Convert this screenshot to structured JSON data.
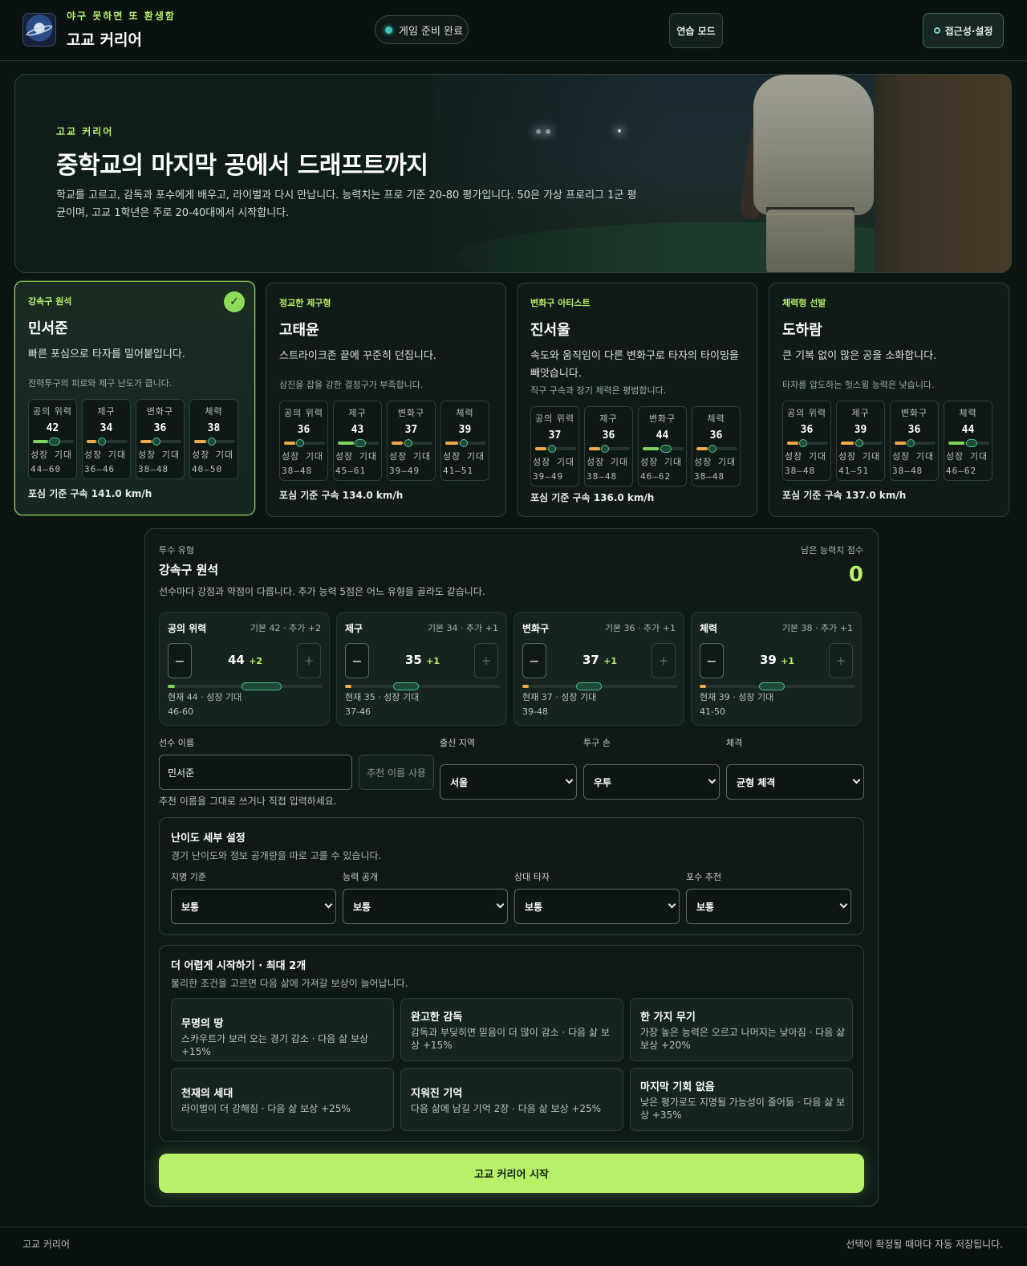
{
  "header": {
    "tagline": "야구 못하면 또 환생함",
    "title": "고교 커리어",
    "status": "게임 준비 완료",
    "practice_label": "연습 모드",
    "settings_label": "접근성·설정"
  },
  "hero": {
    "kicker": "고교 커리어",
    "title": "중학교의 마지막 공에서 드래프트까지",
    "description": "학교를 고르고, 감독과 포수에게 배우고, 라이벌과 다시 만납니다. 능력치는 프로 기준 20-80 평가입니다. 50은 가상 프로리그 1군 평균이며, 고교 1학년은 주로 20-40대에서 시작합니다."
  },
  "stat_labels": [
    "공의 위력",
    "제구",
    "변화구",
    "체력"
  ],
  "growth_label": "성장 기대",
  "pitchers": [
    {
      "type": "강속구 원석",
      "name": "민서준",
      "selected": true,
      "description": "빠른 포심으로 타자를 밀어붙입니다.",
      "weakness": "전력투구의 피로와 제구 난도가 큽니다.",
      "stats": [
        {
          "value": "42",
          "growth": "44–60",
          "level": 42,
          "pot_min": 44,
          "pot_max": 60
        },
        {
          "value": "34",
          "growth": "36–46",
          "level": 34,
          "pot_min": 36,
          "pot_max": 46
        },
        {
          "value": "36",
          "growth": "38–48",
          "level": 36,
          "pot_min": 38,
          "pot_max": 48
        },
        {
          "value": "38",
          "growth": "40–50",
          "level": 38,
          "pot_min": 40,
          "pot_max": 50
        }
      ],
      "velocity": "포심 기준 구속 141.0 km/h"
    },
    {
      "type": "정교한 제구형",
      "name": "고태윤",
      "selected": false,
      "description": "스트라이크존 끝에 꾸준히 던집니다.",
      "weakness": "삼진을 잡을 강한 결정구가 부족합니다.",
      "stats": [
        {
          "value": "36",
          "growth": "38–48",
          "level": 36,
          "pot_min": 38,
          "pot_max": 48
        },
        {
          "value": "43",
          "growth": "45–61",
          "level": 43,
          "pot_min": 45,
          "pot_max": 61
        },
        {
          "value": "37",
          "growth": "39–49",
          "level": 37,
          "pot_min": 39,
          "pot_max": 49
        },
        {
          "value": "39",
          "growth": "41–51",
          "level": 39,
          "pot_min": 41,
          "pot_max": 51
        }
      ],
      "velocity": "포심 기준 구속 134.0 km/h"
    },
    {
      "type": "변화구 아티스트",
      "name": "진서울",
      "selected": false,
      "description": "속도와 움직임이 다른 변화구로 타자의 타이밍을 빼앗습니다.",
      "weakness": "직구 구속과 장기 체력은 평범합니다.",
      "stats": [
        {
          "value": "37",
          "growth": "39–49",
          "level": 37,
          "pot_min": 39,
          "pot_max": 49
        },
        {
          "value": "36",
          "growth": "38–48",
          "level": 36,
          "pot_min": 38,
          "pot_max": 48
        },
        {
          "value": "44",
          "growth": "46–62",
          "level": 44,
          "pot_min": 46,
          "pot_max": 62
        },
        {
          "value": "36",
          "growth": "38–48",
          "level": 36,
          "pot_min": 38,
          "pot_max": 48
        }
      ],
      "velocity": "포심 기준 구속 136.0 km/h"
    },
    {
      "type": "체력형 선발",
      "name": "도하람",
      "selected": false,
      "description": "큰 기복 없이 많은 공을 소화합니다.",
      "weakness": "타자를 압도하는 헛스윙 능력은 낮습니다.",
      "stats": [
        {
          "value": "36",
          "growth": "38–48",
          "level": 36,
          "pot_min": 38,
          "pot_max": 48
        },
        {
          "value": "39",
          "growth": "41–51",
          "level": 39,
          "pot_min": 41,
          "pot_max": 51
        },
        {
          "value": "36",
          "growth": "38–48",
          "level": 36,
          "pot_min": 38,
          "pot_max": 48
        },
        {
          "value": "44",
          "growth": "46–62",
          "level": 44,
          "pot_min": 46,
          "pot_max": 62
        }
      ],
      "velocity": "포심 기준 구속 137.0 km/h"
    }
  ],
  "panel": {
    "type_label": "투수 유형",
    "type_name": "강속구 원석",
    "description": "선수마다 강점과 약점이 다릅니다. 추가 능력 5점은 어느 유형을 골라도 같습니다.",
    "remaining_label": "남은 능력치 점수",
    "remaining_value": "0",
    "allocations": [
      {
        "name": "공의 위력",
        "base": "기본 42 · 추가 +2",
        "value": "44",
        "add": "+2",
        "current": "현재 44 · 성장 기대",
        "range": "46-60",
        "level": 44,
        "pot_min": 46,
        "pot_max": 60
      },
      {
        "name": "제구",
        "base": "기본 34 · 추가 +1",
        "value": "35",
        "add": "+1",
        "current": "현재 35 · 성장 기대",
        "range": "37-46",
        "level": 35,
        "pot_min": 37,
        "pot_max": 46
      },
      {
        "name": "변화구",
        "base": "기본 36 · 추가 +1",
        "value": "37",
        "add": "+1",
        "current": "현재 37 · 성장 기대",
        "range": "39-48",
        "level": 37,
        "pot_min": 39,
        "pot_max": 48
      },
      {
        "name": "체력",
        "base": "기본 38 · 추가 +1",
        "value": "39",
        "add": "+1",
        "current": "현재 39 · 성장 기대",
        "range": "41-50",
        "level": 39,
        "pot_min": 41,
        "pot_max": 50
      }
    ],
    "minus": "−",
    "plus": "+",
    "name_label": "선수 이름",
    "name_value": "민서준",
    "suggest_label": "추천 이름 사용",
    "name_hint": "추천 이름을 그대로 쓰거나 직접 입력하세요.",
    "region_label": "출신 지역",
    "region_value": "서울",
    "hand_label": "투구 손",
    "hand_value": "우투",
    "build_label": "체격",
    "build_value": "균형 체격"
  },
  "difficulty": {
    "title": "난이도 세부 설정",
    "description": "경기 난이도와 정보 공개량을 따로 고를 수 있습니다.",
    "fields": [
      {
        "label": "지명 기준",
        "value": "보통"
      },
      {
        "label": "능력 공개",
        "value": "보통"
      },
      {
        "label": "상대 타자",
        "value": "보통"
      },
      {
        "label": "포수 추천",
        "value": "보통"
      }
    ]
  },
  "challenges": {
    "title": "더 어렵게 시작하기 · 최대 2개",
    "description": "불리한 조건을 고르면 다음 삶에 가져갈 보상이 늘어납니다.",
    "items": [
      {
        "title": "무명의 땅",
        "desc": "스카우트가 보러 오는 경기 감소 · 다음 삶 보상 +15%"
      },
      {
        "title": "완고한 감독",
        "desc": "감독과 부딪히면 믿음이 더 많이 감소 · 다음 삶 보상 +15%"
      },
      {
        "title": "한 가지 무기",
        "desc": "가장 높은 능력은 오르고 나머지는 낮아짐 · 다음 삶 보상 +20%"
      },
      {
        "title": "천재의 세대",
        "desc": "라이벌이 더 강해짐 · 다음 삶 보상 +25%"
      },
      {
        "title": "지워진 기억",
        "desc": "다음 삶에 남길 기억 2장 · 다음 삶 보상 +25%"
      },
      {
        "title": "마지막 기회 없음",
        "desc": "낮은 평가로도 지명될 가능성이 줄어듦 · 다음 삶 보상 +35%"
      }
    ]
  },
  "start_label": "고교 커리어 시작",
  "footer": {
    "left": "고교 커리어",
    "right": "선택이 확정될 때마다 자동 저장됩니다."
  },
  "colors": {
    "accent": "#b8f06a",
    "bar_low": "#f0a84a",
    "bar_high": "#7fd35a",
    "potential": "#4fbf8a"
  }
}
